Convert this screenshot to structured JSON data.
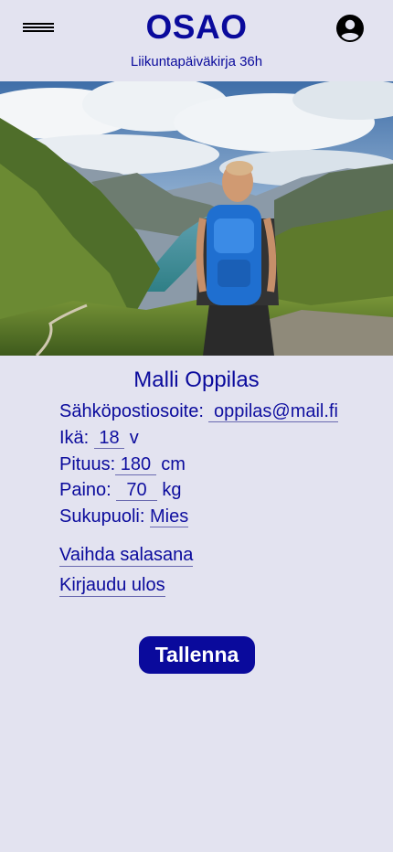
{
  "header": {
    "brand": "OSAO",
    "subtitle": "Liikuntapäiväkirja 36h"
  },
  "profile": {
    "name": "Malli Oppilas",
    "email_label": "Sähköpostiosoite:",
    "email_value": "oppilas@mail.fi",
    "age_label": "Ikä:",
    "age_value": "18",
    "age_unit": "v",
    "height_label": "Pituus:",
    "height_value": "180",
    "height_unit": "cm",
    "weight_label": "Paino:",
    "weight_value": "70",
    "weight_unit": "kg",
    "gender_label": "Sukupuoli:",
    "gender_value": "Mies"
  },
  "links": {
    "change_password": "Vaihda salasana",
    "logout": "Kirjaudu ulos"
  },
  "save_label": "Tallenna",
  "colors": {
    "background": "#e3e3f0",
    "accent": "#0a0a9c"
  }
}
